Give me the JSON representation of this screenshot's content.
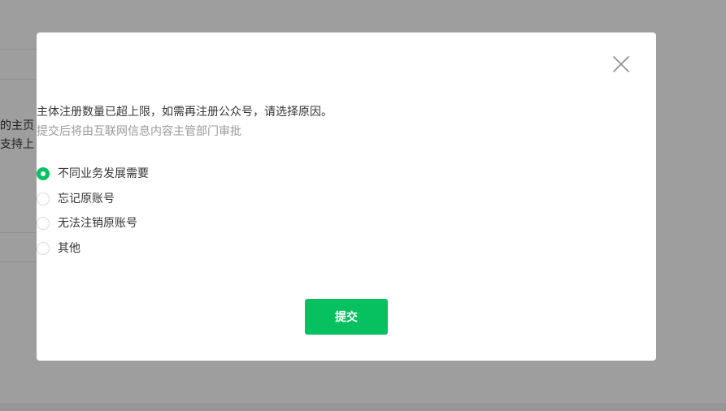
{
  "background": {
    "text_fragment_1": "的主页",
    "text_fragment_2": "支持上"
  },
  "dialog": {
    "close_icon": "close-icon",
    "description": "主体注册数量已超上限，如需再注册公众号，请选择原因。",
    "tip": "提交后将由互联网信息内容主管部门审批",
    "options": [
      {
        "label": "不同业务发展需要",
        "checked": true
      },
      {
        "label": "忘记原账号",
        "checked": false
      },
      {
        "label": "无法注销原账号",
        "checked": false
      },
      {
        "label": "其他",
        "checked": false
      }
    ],
    "submit_label": "提交"
  },
  "colors": {
    "accent": "#07c160",
    "text": "#353535",
    "muted": "#9a9a9a"
  }
}
